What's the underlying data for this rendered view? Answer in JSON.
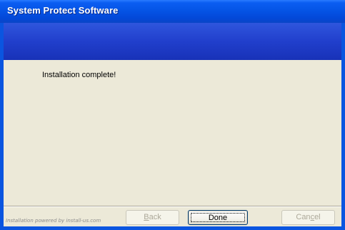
{
  "window": {
    "title": "System Protect Software"
  },
  "content": {
    "message": "Installation complete!"
  },
  "footer": {
    "powered_by": "Installation powered by install-us.com"
  },
  "buttons": {
    "back": {
      "accel": "B",
      "rest": "ack"
    },
    "done": {
      "label": "Done"
    },
    "cancel": {
      "pre": "Can",
      "accel": "c",
      "rest": "el"
    }
  },
  "colors": {
    "titlebar": "#0554e6",
    "banner": "#213fcc",
    "client": "#ece9d8",
    "disabled_text": "#aca899"
  }
}
